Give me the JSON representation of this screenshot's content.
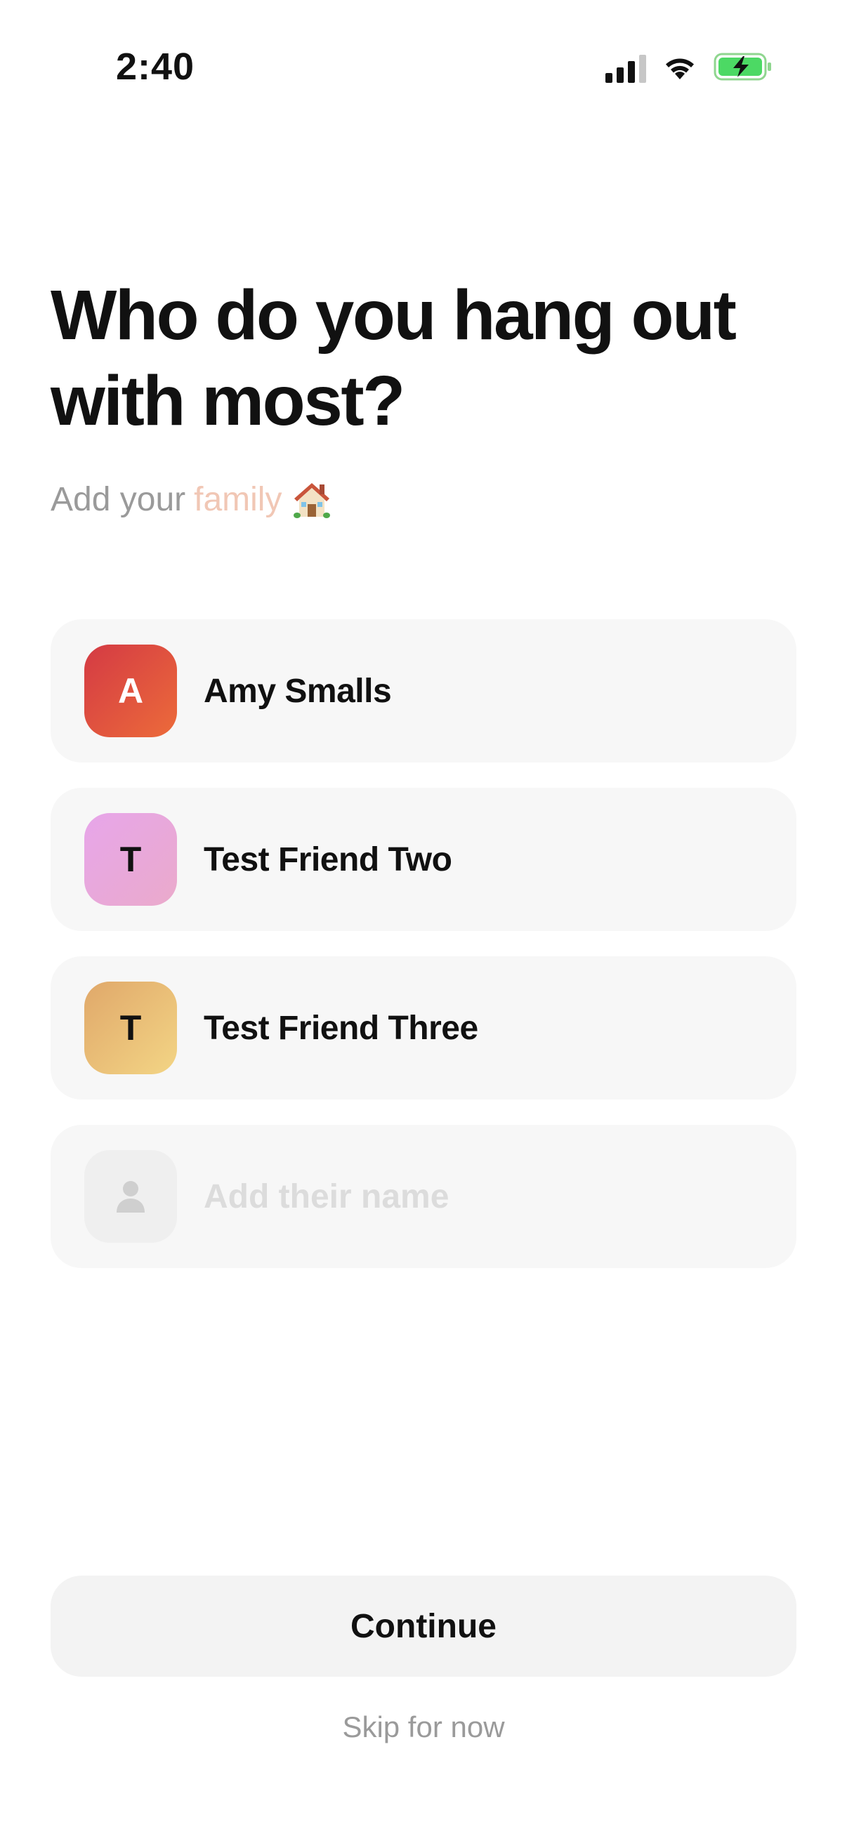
{
  "status_bar": {
    "time": "2:40",
    "signal_icon": "cellular-signal-icon",
    "wifi_icon": "wifi-icon",
    "battery_icon": "battery-charging-icon",
    "battery_color": "#4cd964"
  },
  "header": {
    "title": "Who do you hang out with most?",
    "subtitle_prefix": "Add your",
    "subtitle_accent": "family",
    "subtitle_icon": "house-icon",
    "accent_color": "#f1c7b5"
  },
  "friends": [
    {
      "initial": "A",
      "name": "Amy Smalls"
    },
    {
      "initial": "T",
      "name": "Test Friend Two"
    },
    {
      "initial": "T",
      "name": "Test Friend Three"
    }
  ],
  "new_friend": {
    "placeholder": "Add their name",
    "avatar_icon": "person-icon"
  },
  "actions": {
    "continue_label": "Continue",
    "skip_label": "Skip for now"
  }
}
